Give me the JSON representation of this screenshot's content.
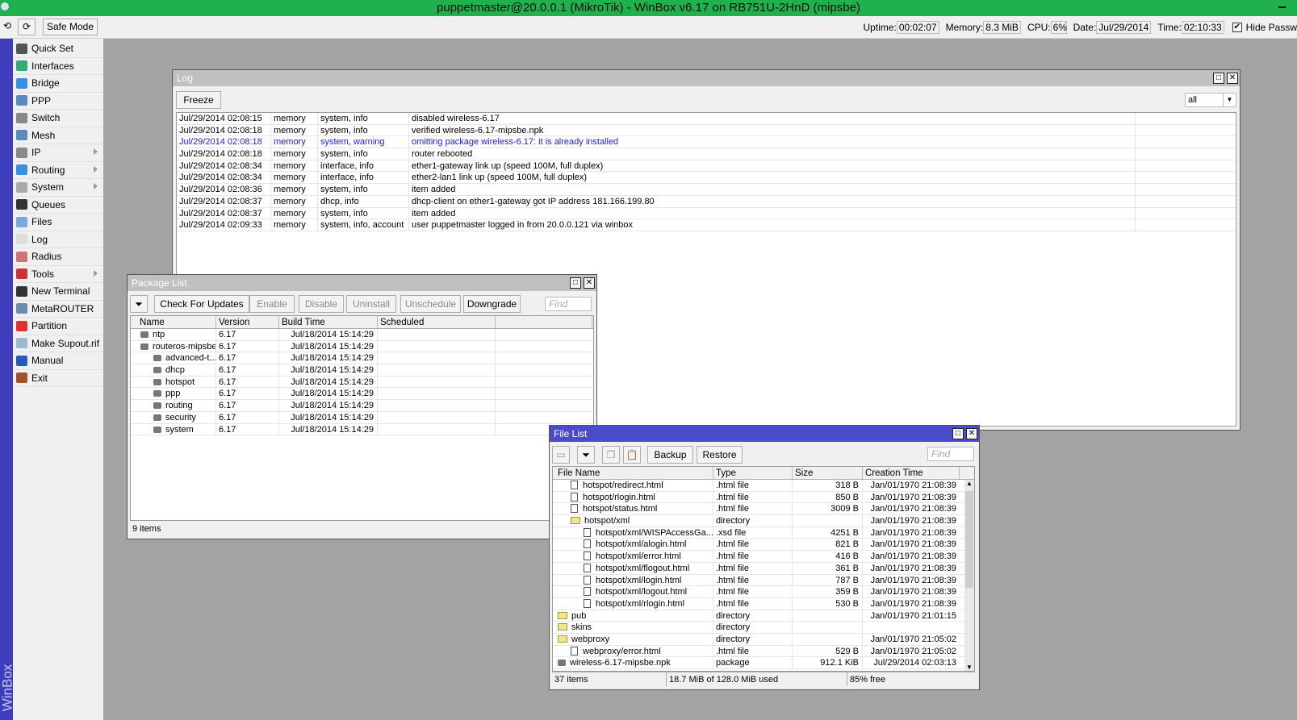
{
  "window_title": "puppetmaster@20.0.0.1 (MikroTik) - WinBox v6.17 on RB751U-2HnD (mipsbe)",
  "toolbar": {
    "undo_icon": "undo-icon",
    "redo_icon": "redo-icon",
    "safe_mode": "Safe Mode",
    "uptime_label": "Uptime:",
    "uptime": "00:02:07",
    "memory_label": "Memory:",
    "memory": "8.3 MiB",
    "cpu_label": "CPU:",
    "cpu": "6%",
    "date_label": "Date:",
    "date": "Jul/29/2014",
    "time_label": "Time:",
    "time": "02:10:33",
    "hide_passwords": "Hide Passw",
    "hide_passwords_checked": true
  },
  "side_label": "WinBox",
  "sidebar": {
    "items": [
      {
        "label": "Quick Set",
        "icon": "wand-icon",
        "color": "#555"
      },
      {
        "label": "Interfaces",
        "icon": "network-card-icon",
        "color": "#3a7"
      },
      {
        "label": "Bridge",
        "icon": "bridge-icon",
        "color": "#3a8fe0"
      },
      {
        "label": "PPP",
        "icon": "ppp-icon",
        "color": "#5a8ac0"
      },
      {
        "label": "Switch",
        "icon": "switch-icon",
        "color": "#888"
      },
      {
        "label": "Mesh",
        "icon": "mesh-icon",
        "color": "#5a8ac0"
      },
      {
        "label": "IP",
        "icon": "ip-icon",
        "color": "#888",
        "submenu": true
      },
      {
        "label": "Routing",
        "icon": "routing-icon",
        "color": "#3a8fe0",
        "submenu": true
      },
      {
        "label": "System",
        "icon": "gear-icon",
        "color": "#aaa",
        "submenu": true
      },
      {
        "label": "Queues",
        "icon": "gauge-icon",
        "color": "#333"
      },
      {
        "label": "Files",
        "icon": "folder-icon",
        "color": "#7aa8d8"
      },
      {
        "label": "Log",
        "icon": "document-icon",
        "color": "#ddd"
      },
      {
        "label": "Radius",
        "icon": "users-icon",
        "color": "#c77"
      },
      {
        "label": "Tools",
        "icon": "tools-icon",
        "color": "#c33",
        "submenu": true
      },
      {
        "label": "New Terminal",
        "icon": "terminal-icon",
        "color": "#333"
      },
      {
        "label": "MetaROUTER",
        "icon": "metarouter-icon",
        "color": "#6a8ab0"
      },
      {
        "label": "Partition",
        "icon": "pie-icon",
        "color": "#d33"
      },
      {
        "label": "Make Supout.rif",
        "icon": "file-export-icon",
        "color": "#9bc"
      },
      {
        "label": "Manual",
        "icon": "help-icon",
        "color": "#2a5ab8"
      },
      {
        "label": "Exit",
        "icon": "door-icon",
        "color": "#a0522d"
      }
    ]
  },
  "log": {
    "title": "Log",
    "freeze": "Freeze",
    "filter": "all",
    "warning_color": "#1a1aff",
    "rows": [
      [
        "Jul/29/2014 02:08:15",
        "memory",
        "system, info",
        "disabled wireless-6.17"
      ],
      [
        "Jul/29/2014 02:08:18",
        "memory",
        "system, info",
        "verified wireless-6.17-mipsbe.npk"
      ],
      [
        "Jul/29/2014 02:08:18",
        "memory",
        "system, warning",
        "omitting package wireless-6.17: it is already installed"
      ],
      [
        "Jul/29/2014 02:08:18",
        "memory",
        "system, info",
        "router rebooted"
      ],
      [
        "Jul/29/2014 02:08:34",
        "memory",
        "interface, info",
        "ether1-gateway link up (speed 100M, full duplex)"
      ],
      [
        "Jul/29/2014 02:08:34",
        "memory",
        "interface, info",
        "ether2-lan1 link up (speed 100M, full duplex)"
      ],
      [
        "Jul/29/2014 02:08:36",
        "memory",
        "system, info",
        "item added"
      ],
      [
        "Jul/29/2014 02:08:37",
        "memory",
        "dhcp, info",
        "dhcp-client on ether1-gateway got IP address 181.166.199.80"
      ],
      [
        "Jul/29/2014 02:08:37",
        "memory",
        "system, info",
        "item added"
      ],
      [
        "Jul/29/2014 02:09:33",
        "memory",
        "system, info, account",
        "user puppetmaster logged in from 20.0.0.121 via winbox"
      ]
    ]
  },
  "packages": {
    "title": "Package List",
    "buttons": [
      "Check For Updates",
      "Enable",
      "Disable",
      "Uninstall",
      "Unschedule",
      "Downgrade"
    ],
    "find": "Find",
    "columns": [
      "Name",
      "Version",
      "Build Time",
      "Scheduled"
    ],
    "rows": [
      {
        "name": "ntp",
        "version": "6.17",
        "build": "Jul/18/2014 15:14:29",
        "level": 0
      },
      {
        "name": "routeros-mipsbe",
        "version": "6.17",
        "build": "Jul/18/2014 15:14:29",
        "level": 0
      },
      {
        "name": "advanced-t...",
        "version": "6.17",
        "build": "Jul/18/2014 15:14:29",
        "level": 1
      },
      {
        "name": "dhcp",
        "version": "6.17",
        "build": "Jul/18/2014 15:14:29",
        "level": 1
      },
      {
        "name": "hotspot",
        "version": "6.17",
        "build": "Jul/18/2014 15:14:29",
        "level": 1
      },
      {
        "name": "ppp",
        "version": "6.17",
        "build": "Jul/18/2014 15:14:29",
        "level": 1
      },
      {
        "name": "routing",
        "version": "6.17",
        "build": "Jul/18/2014 15:14:29",
        "level": 1
      },
      {
        "name": "security",
        "version": "6.17",
        "build": "Jul/18/2014 15:14:29",
        "level": 1
      },
      {
        "name": "system",
        "version": "6.17",
        "build": "Jul/18/2014 15:14:29",
        "level": 1
      }
    ],
    "status": "9 items"
  },
  "files": {
    "title": "File List",
    "backup": "Backup",
    "restore": "Restore",
    "find": "Find",
    "columns": [
      "File Name",
      "Type",
      "Size",
      "Creation Time"
    ],
    "rows": [
      {
        "name": "hotspot/redirect.html",
        "type": ".html file",
        "size": "318 B",
        "time": "Jan/01/1970 21:08:39",
        "level": 1,
        "kind": "file"
      },
      {
        "name": "hotspot/rlogin.html",
        "type": ".html file",
        "size": "850 B",
        "time": "Jan/01/1970 21:08:39",
        "level": 1,
        "kind": "file"
      },
      {
        "name": "hotspot/status.html",
        "type": ".html file",
        "size": "3009 B",
        "time": "Jan/01/1970 21:08:39",
        "level": 1,
        "kind": "file"
      },
      {
        "name": "hotspot/xml",
        "type": "directory",
        "size": "",
        "time": "Jan/01/1970 21:08:39",
        "level": 1,
        "kind": "dir"
      },
      {
        "name": "hotspot/xml/WISPAccessGa...",
        "type": ".xsd file",
        "size": "4251 B",
        "time": "Jan/01/1970 21:08:39",
        "level": 2,
        "kind": "file"
      },
      {
        "name": "hotspot/xml/alogin.html",
        "type": ".html file",
        "size": "821 B",
        "time": "Jan/01/1970 21:08:39",
        "level": 2,
        "kind": "file"
      },
      {
        "name": "hotspot/xml/error.html",
        "type": ".html file",
        "size": "416 B",
        "time": "Jan/01/1970 21:08:39",
        "level": 2,
        "kind": "file"
      },
      {
        "name": "hotspot/xml/flogout.html",
        "type": ".html file",
        "size": "361 B",
        "time": "Jan/01/1970 21:08:39",
        "level": 2,
        "kind": "file"
      },
      {
        "name": "hotspot/xml/login.html",
        "type": ".html file",
        "size": "787 B",
        "time": "Jan/01/1970 21:08:39",
        "level": 2,
        "kind": "file"
      },
      {
        "name": "hotspot/xml/logout.html",
        "type": ".html file",
        "size": "359 B",
        "time": "Jan/01/1970 21:08:39",
        "level": 2,
        "kind": "file"
      },
      {
        "name": "hotspot/xml/rlogin.html",
        "type": ".html file",
        "size": "530 B",
        "time": "Jan/01/1970 21:08:39",
        "level": 2,
        "kind": "file"
      },
      {
        "name": "pub",
        "type": "directory",
        "size": "",
        "time": "Jan/01/1970 21:01:15",
        "level": 0,
        "kind": "dir"
      },
      {
        "name": "skins",
        "type": "directory",
        "size": "",
        "time": "",
        "level": 0,
        "kind": "dir"
      },
      {
        "name": "webproxy",
        "type": "directory",
        "size": "",
        "time": "Jan/01/1970 21:05:02",
        "level": 0,
        "kind": "dir"
      },
      {
        "name": "webproxy/error.html",
        "type": ".html file",
        "size": "529 B",
        "time": "Jan/01/1970 21:05:02",
        "level": 1,
        "kind": "file"
      },
      {
        "name": "wireless-6.17-mipsbe.npk",
        "type": "package",
        "size": "912.1 KiB",
        "time": "Jul/29/2014 02:03:13",
        "level": 0,
        "kind": "pkg"
      }
    ],
    "status": [
      "37 items",
      "18.7 MiB of 128.0 MiB used",
      "85% free"
    ]
  }
}
